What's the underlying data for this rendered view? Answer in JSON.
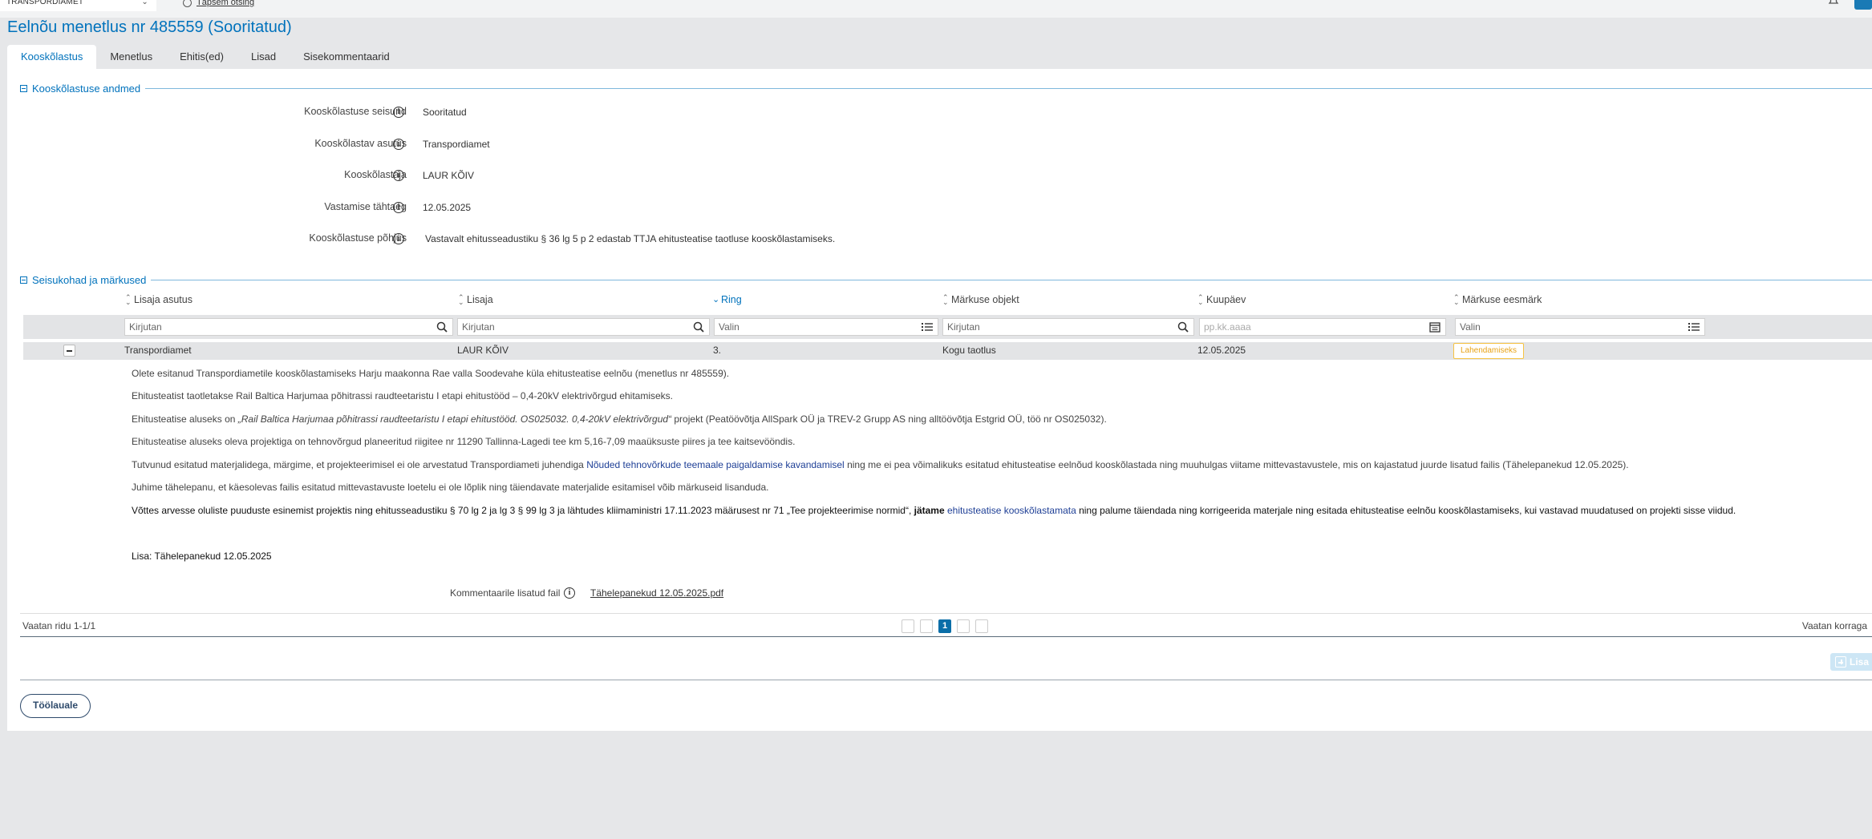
{
  "topbar": {
    "org": "TRANSPORDIAMET",
    "search_label": "Täpsem otsing"
  },
  "title": "Eelnõu menetlus nr 485559 (Sooritatud)",
  "tabs": [
    "Kooskõlastus",
    "Menetlus",
    "Ehitis(ed)",
    "Lisad",
    "Sisekommentaarid"
  ],
  "section1": {
    "title": "Kooskõlastuse andmed",
    "fields": [
      {
        "label": "Kooskõlastuse seisund",
        "value": "Sooritatud"
      },
      {
        "label": "Kooskõlastav asutus",
        "value": "Transpordiamet"
      },
      {
        "label": "Kooskõlastaja",
        "value": "LAUR KÕIV"
      },
      {
        "label": "Vastamise tähtaeg",
        "value": "12.05.2025"
      },
      {
        "label": "Kooskõlastuse põhjus",
        "value": "Vastavalt ehitusseadustiku § 36 lg 5 p 2 edastab TTJA ehitusteatise taotluse kooskõlastamiseks."
      }
    ]
  },
  "section2": {
    "title": "Seisukohad ja märkused",
    "columns": [
      "Lisaja asutus",
      "Lisaja",
      "Ring",
      "Märkuse objekt",
      "Kuupäev",
      "Märkuse eesmärk"
    ],
    "filters": [
      "Kirjutan",
      "Kirjutan",
      "Valin",
      "Kirjutan",
      "pp.kk.aaaa",
      "Valin"
    ],
    "row": {
      "agency": "Transpordiamet",
      "author": "LAUR KÕIV",
      "round": "3.",
      "object": "Kogu taotlus",
      "date": "12.05.2025",
      "purpose": "Lahendamiseks"
    },
    "paragraphs": {
      "p1": "Olete esitanud Transpordiametile kooskõlastamiseks Harju maakonna Rae valla Soodevahe küla ehitusteatise eelnõu (menetlus nr 485559).",
      "p2": "Ehitusteatist taotletakse Rail Baltica Harjumaa põhitrassi raudteetaristu I etapi ehitustööd – 0,4-20kV elektrivõrgud ehitamiseks.",
      "p3a": "Ehitusteatise aluseks on ",
      "p3b": "„Rail Baltica Harjumaa põhitrassi raudteetaristu I etapi ehitustööd. OS025032. 0,4-20kV elektrivõrgud“",
      "p3c": " projekt (Peatöövõtja AllSpark OÜ ja TREV-2 Grupp AS ning alltöövõtja Estgrid OÜ, töö nr OS025032).",
      "p4": "Ehitusteatise aluseks oleva projektiga on tehnovõrgud planeeritud riigitee nr 11290  Tallinna-Lagedi tee km 5,16-7,09 maaüksuste piires ja tee kaitsevööndis.",
      "p5a": "Tutvunud esitatud materjalidega, märgime, et projekteerimisel ei ole arvestatud Transpordiameti juhendiga ",
      "p5b": "Nõuded tehnovõrkude teemaale paigaldamise kavandamisel",
      "p5c": " ning me ei pea võimalikuks esitatud ehitusteatise eelnõud kooskõlastada ning muuhulgas viitame mittevastavustele, mis on kajastatud juurde lisatud failis (Tähelepanekud 12.05.2025).",
      "p6": "Juhime tähelepanu, et käesolevas failis esitatud mittevastavuste loetelu ei ole lõplik ning täiendavate materjalide esitamisel võib märkuseid lisanduda.",
      "p7a": "Võttes arvesse olulistе puuduste esinemist projektis ning ehitusseadustiku § 70 lg 2 ja lg 3 § 99 lg 3 ja lähtudes kliimaministri 17.11.2023 määrusest nr 71 „Tee projekteerimise normid“, ",
      "p7b": "jätame",
      "p7c": " ehitusteatise kooskõlastamata",
      "p7d": " ning palume täiendada ning korrigeerida materjale ning esitada ehitusteatise eelnõu kooskõlastamiseks, kui vastavad muudatused on projekti sisse viidud.",
      "p8": "Lisa: Tähelepanekud 12.05.2025"
    },
    "attachment_label": "Kommentaarile lisatud fail",
    "attachment_file": "Tähelepanekud 12.05.2025.pdf",
    "pager_left": "Vaatan ridu 1-1/1",
    "pager_current": "1",
    "pager_right": "Vaatan korraga",
    "add_label": "Lisa"
  },
  "back_button": "Töölauale",
  "colors": {
    "accent": "#0072bc",
    "badge": "#f6c343"
  }
}
